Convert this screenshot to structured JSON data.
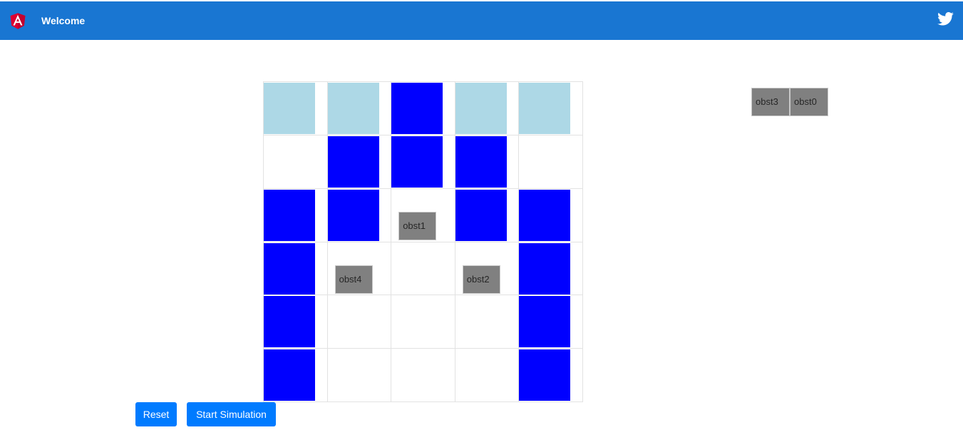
{
  "header": {
    "title": "Welcome",
    "logo_icon": "angular-logo-icon",
    "social_icon": "twitter-icon",
    "background": "#1976d2"
  },
  "grid": {
    "columns": 5,
    "rows": [
      [
        {
          "fill": "light"
        },
        {
          "fill": "light"
        },
        {
          "fill": "blue"
        },
        {
          "fill": "light"
        },
        {
          "fill": "light"
        }
      ],
      [
        {
          "fill": null
        },
        {
          "fill": "blue"
        },
        {
          "fill": "blue"
        },
        {
          "fill": "blue"
        },
        {
          "fill": null
        }
      ],
      [
        {
          "fill": "blue"
        },
        {
          "fill": "blue"
        },
        {
          "fill": null,
          "obstacle": "obst1"
        },
        {
          "fill": "blue"
        },
        {
          "fill": "blue"
        }
      ],
      [
        {
          "fill": "blue"
        },
        {
          "fill": null,
          "obstacle": "obst4"
        },
        {
          "fill": null
        },
        {
          "fill": null,
          "obstacle": "obst2"
        },
        {
          "fill": "blue"
        }
      ],
      [
        {
          "fill": "blue"
        },
        {
          "fill": null
        },
        {
          "fill": null
        },
        {
          "fill": null
        },
        {
          "fill": "blue"
        }
      ],
      [
        {
          "fill": "blue"
        },
        {
          "fill": null
        },
        {
          "fill": null
        },
        {
          "fill": null
        },
        {
          "fill": "blue"
        }
      ]
    ],
    "colors": {
      "blue": "#0000ff",
      "light": "#add8e6",
      "obstacle": "#808080"
    }
  },
  "palette": {
    "obstacles": [
      "obst3",
      "obst0"
    ]
  },
  "buttons": {
    "reset_label": "Reset",
    "start_label": "Start Simulation",
    "color": "#007bff"
  }
}
